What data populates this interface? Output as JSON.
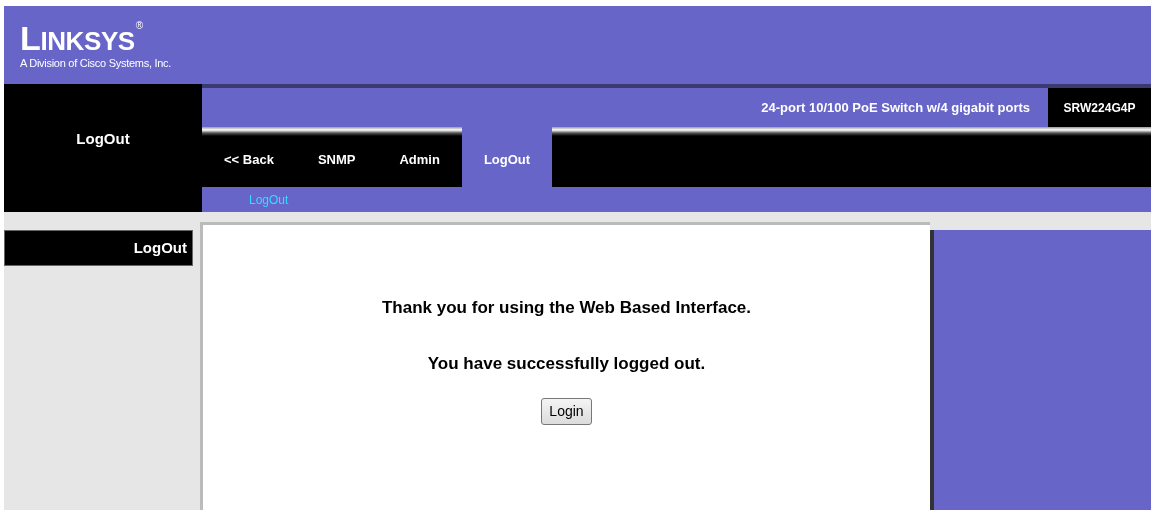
{
  "logo": {
    "wordmark": "LINKSYS",
    "registered": "®",
    "tagline": "A Division of Cisco Systems, Inc."
  },
  "section_title": "LogOut",
  "product": {
    "description": "24-port 10/100 PoE Switch w/4 gigabit ports",
    "model": "SRW224G4P"
  },
  "tabs": [
    {
      "label": "<< Back",
      "selected": false
    },
    {
      "label": "SNMP",
      "selected": false
    },
    {
      "label": "Admin",
      "selected": false
    },
    {
      "label": "LogOut",
      "selected": true
    }
  ],
  "subtabs": [
    {
      "label": "LogOut",
      "selected": true
    }
  ],
  "sidebar": {
    "items": [
      {
        "label": "LogOut",
        "selected": true
      }
    ]
  },
  "content": {
    "messages": [
      "Thank you for using the Web Based Interface.",
      "You have successfully logged out."
    ],
    "button": "Login"
  }
}
